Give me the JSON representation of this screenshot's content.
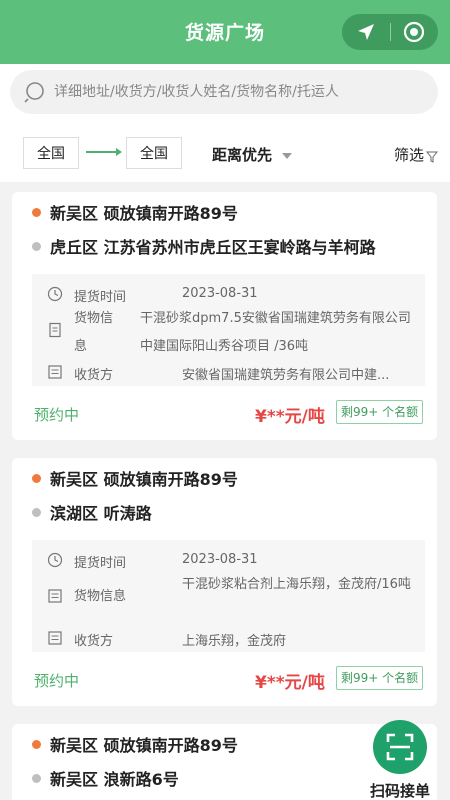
{
  "header": {
    "title": "货源广场",
    "locate_icon": "navigation-arrow-icon",
    "target_icon": "target-circle-icon"
  },
  "search": {
    "placeholder": "详细地址/收货方/收货人姓名/货物名称/托运人"
  },
  "filters": {
    "from": "全国",
    "to": "全国",
    "sort": "距离优先",
    "filter": "筛选"
  },
  "orders": [
    {
      "from": "新吴区 硕放镇南开路89号",
      "to": "虎丘区 江苏省苏州市虎丘区王宴岭路与羊柯路",
      "pickup_label": "提货时间",
      "pickup": "2023-08-31",
      "goods_label": "货物信息",
      "goods": "干混砂浆dpm7.5安徽省国瑞建筑劳务有限公司中建国际阳山秀谷项目 /36吨",
      "receiver_label": "收货方",
      "receiver": "安徽省国瑞建筑劳务有限公司中建...",
      "status": "预约中",
      "price": "¥**元/吨",
      "quota": "剩99+ 个名额"
    },
    {
      "from": "新吴区 硕放镇南开路89号",
      "to": "滨湖区 听涛路",
      "pickup_label": "提货时间",
      "pickup": "2023-08-31",
      "goods_label": "货物信息",
      "goods": "干混砂浆粘合剂上海乐翔，金茂府/16吨",
      "receiver_label": "收货方",
      "receiver": "上海乐翔，金茂府",
      "status": "预约中",
      "price": "¥**元/吨",
      "quota": "剩99+ 个名额"
    },
    {
      "from": "新吴区 硕放镇南开路89号",
      "to": "新吴区 浪新路6号"
    }
  ],
  "scan": {
    "label": "扫码接单"
  },
  "colors": {
    "brand_green": "#5cbf7c",
    "origin_dot": "#f07a3c",
    "price_red": "#e54747",
    "status_green": "#4fb06e"
  }
}
